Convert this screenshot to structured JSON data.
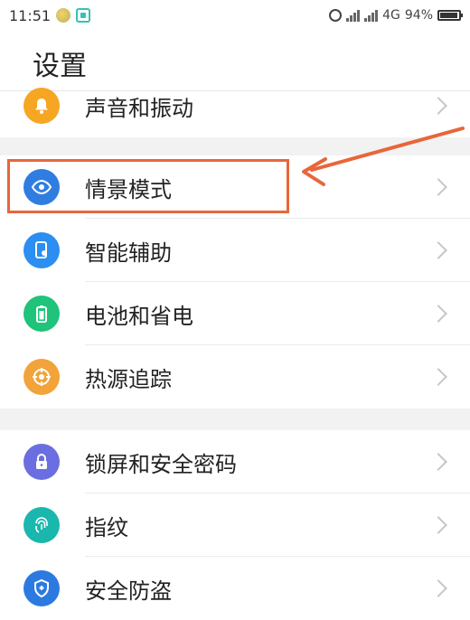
{
  "status_bar": {
    "time": "11:51",
    "network": "4G",
    "battery": "94%"
  },
  "header": {
    "title": "设置"
  },
  "items": [
    {
      "label": "声音和振动",
      "icon": "bell-icon",
      "color": "#f6a623"
    },
    {
      "label": "情景模式",
      "icon": "eye-icon",
      "color": "#2f7de1"
    },
    {
      "label": "智能辅助",
      "icon": "phone-touch-icon",
      "color": "#2b8ef0"
    },
    {
      "label": "电池和省电",
      "icon": "battery-icon",
      "color": "#1fc37a"
    },
    {
      "label": "热源追踪",
      "icon": "target-icon",
      "color": "#f2a33a"
    },
    {
      "label": "锁屏和安全密码",
      "icon": "lock-icon",
      "color": "#6b6ee0"
    },
    {
      "label": "指纹",
      "icon": "fingerprint-icon",
      "color": "#19b7ad"
    },
    {
      "label": "安全防盗",
      "icon": "shield-icon",
      "color": "#2c7ae0"
    }
  ],
  "annotation": {
    "color": "#e8663a"
  }
}
